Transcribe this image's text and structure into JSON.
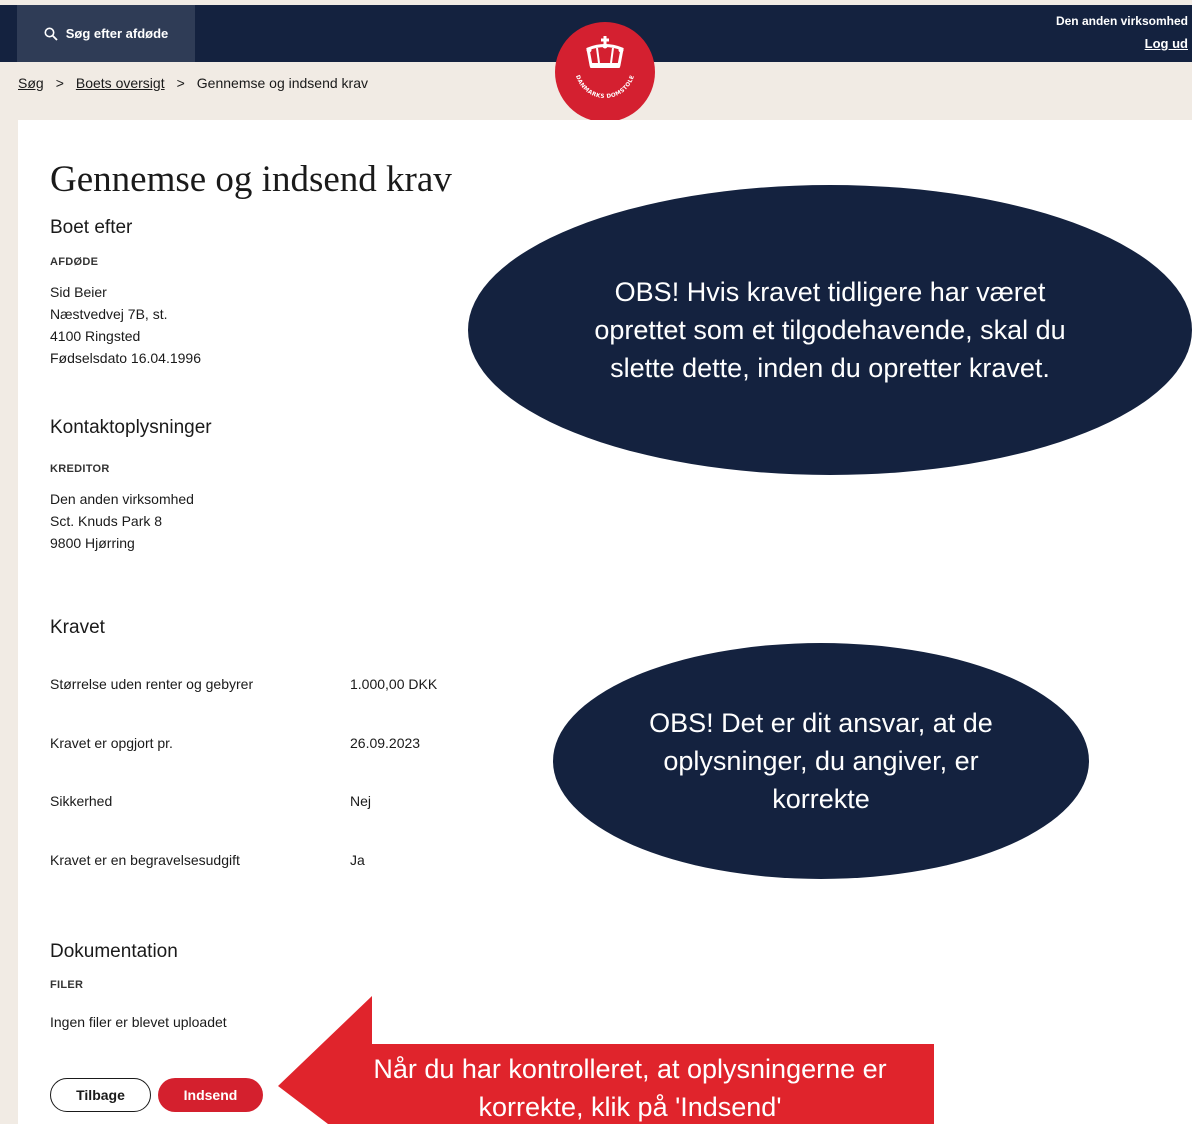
{
  "header": {
    "search_label": "Søg efter afdøde",
    "user_name": "Den anden virksomhed",
    "logout_label": "Log ud",
    "logo_text": "DANMARKS DOMSTOLE"
  },
  "breadcrumb": {
    "items": [
      "Søg",
      "Boets oversigt",
      "Gennemse og indsend krav"
    ],
    "separator": ">"
  },
  "page": {
    "title": "Gennemse og indsend krav",
    "estate": {
      "heading": "Boet efter",
      "label": "AFDØDE",
      "lines": [
        "Sid Beier",
        "Næstvedvej 7B, st.",
        "4100 Ringsted",
        "Fødselsdato 16.04.1996"
      ]
    },
    "contact": {
      "heading": "Kontaktoplysninger",
      "label": "KREDITOR",
      "lines": [
        "Den anden virksomhed",
        "Sct. Knuds Park 8",
        "9800 Hjørring"
      ]
    },
    "claim": {
      "heading": "Kravet",
      "rows": [
        {
          "label": "Størrelse uden renter og gebyrer",
          "value": "1.000,00 DKK"
        },
        {
          "label": "Kravet er opgjort pr.",
          "value": "26.09.2023"
        },
        {
          "label": "Sikkerhed",
          "value": "Nej"
        },
        {
          "label": "Kravet er en begravelsesudgift",
          "value": "Ja"
        }
      ]
    },
    "documentation": {
      "heading": "Dokumentation",
      "label": "FILER",
      "text": "Ingen filer er blevet uploadet"
    },
    "buttons": {
      "back": "Tilbage",
      "submit": "Indsend"
    }
  },
  "callouts": {
    "obs1": "OBS! Hvis kravet tidligere har været oprettet som et tilgodehavende, skal du slette dette, inden du opretter kravet.",
    "obs2": "OBS! Det er dit ansvar, at de oplysninger, du angiver, er korrekte",
    "arrow": "Når du har kontrolleret, at oplysningerne er korrekte, klik på 'Indsend'"
  },
  "colors": {
    "navy": "#14223f",
    "red": "#d4202e",
    "beige": "#f1ebe4"
  }
}
